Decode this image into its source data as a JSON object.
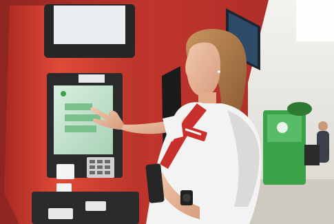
{
  "photo": {
    "kind": "photograph",
    "colors": {
      "kiosk_red": "#d23a2c",
      "kiosk_dark": "#2a2a2a",
      "wall_red": "#b8302a",
      "uniform_white": "#f2f2f2",
      "tie_red": "#c9302c",
      "sign_green": "#3aa34a",
      "screen_green": "#bfe3c7",
      "floor": "#d9d6cf"
    }
  }
}
